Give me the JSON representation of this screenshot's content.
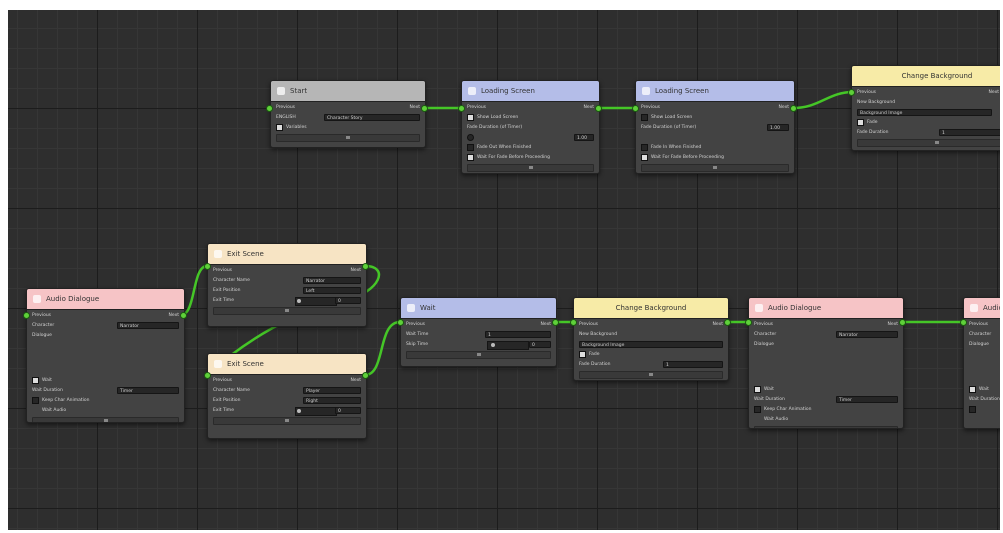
{
  "colors": {
    "canvas": "#2e2e2e",
    "wire": "#45c627",
    "header_gray": "#b6b6b6",
    "header_blue": "#b4bde8",
    "header_yellow": "#f7eba7",
    "header_pink": "#f6c4c6",
    "header_peach": "#f7e4c4"
  },
  "nodes": {
    "start": {
      "title": "Start",
      "previous": "Previous",
      "next": "Next",
      "row1": "ENGLISH",
      "row1_value": "Character Story",
      "row2": "Variables"
    },
    "loading1": {
      "title": "Loading Screen",
      "previous": "Previous",
      "next": "Next",
      "row1": "Show Load Screen",
      "row2": "Fade Duration (of Timer)",
      "value": "1.00",
      "row3": "Fade Out When Finished",
      "row4": "Wait For Fade Before Proceeding"
    },
    "loading2": {
      "title": "Loading Screen",
      "previous": "Previous",
      "next": "Next",
      "row1": "Show Load Screen",
      "row2": "Fade Duration (of Timer)",
      "value": "1.00",
      "row3": "Fade In When Finished",
      "row4": "Wait For Fade Before Proceeding"
    },
    "change_bg1": {
      "title": "Change Background",
      "previous": "Previous",
      "next": "Next",
      "row1": "New Background",
      "field": "Background Image",
      "row2": "Fade",
      "row3": "Fade Duration",
      "value": "1"
    },
    "exit1": {
      "title": "Exit Scene",
      "previous": "Previous",
      "next": "Next",
      "row1": "Character Name",
      "value1": "Narrator",
      "row2": "Exit Position",
      "value2": "Left",
      "row3": "Exit Time",
      "value3": "0"
    },
    "exit2": {
      "title": "Exit Scene",
      "previous": "Previous",
      "next": "Next",
      "row1": "Character Name",
      "value1": "Player",
      "row2": "Exit Position",
      "value2": "Right",
      "row3": "Exit Time",
      "value3": "0"
    },
    "audio1": {
      "title": "Audio Dialogue",
      "previous": "Previous",
      "next": "Next",
      "row1": "Character",
      "value1": "Narrator",
      "row2": "Dialogue",
      "row3": "Wait",
      "row4": "Wait Duration",
      "value2": "Timer",
      "row5": "Keep Char Animation",
      "row6": "Wait Audio"
    },
    "wait": {
      "title": "Wait",
      "previous": "Previous",
      "next": "Next",
      "row1": "Wait Time",
      "value1": "1",
      "row2": "Skip Time",
      "value2": "0"
    },
    "change_bg2": {
      "title": "Change Background",
      "previous": "Previous",
      "next": "Next",
      "row1": "New Background",
      "field": "Background Image",
      "row2": "Fade",
      "row3": "Fade Duration",
      "value": "1"
    },
    "audio2": {
      "title": "Audio Dialogue",
      "previous": "Previous",
      "next": "Next",
      "row1": "Character",
      "value1": "Narrator",
      "row2": "Dialogue",
      "row3": "Wait",
      "row4": "Wait Duration",
      "value2": "Timer",
      "row5": "Keep Char Animation",
      "row6": "Wait Audio"
    },
    "audio3": {
      "title": "Audio",
      "previous": "Previous",
      "row1": "Character",
      "row2": "Dialogue",
      "row3": "Wait",
      "row4": "Wait Duration"
    }
  }
}
